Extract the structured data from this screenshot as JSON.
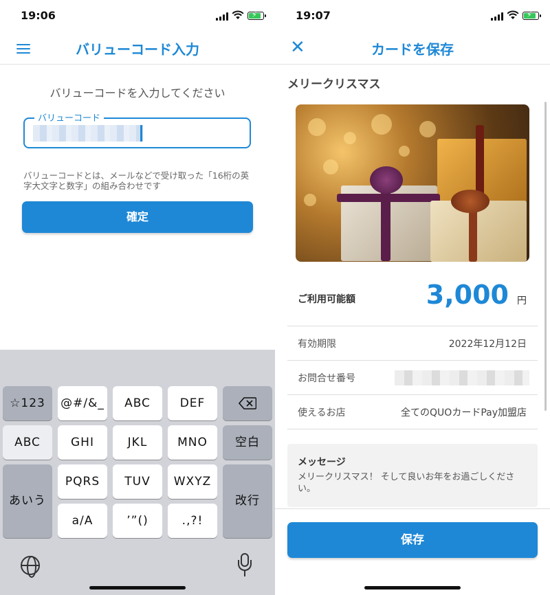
{
  "left": {
    "status_time": "19:06",
    "header_title": "バリューコード入力",
    "prompt": "バリューコードを入力してください",
    "field_label": "バリューコード",
    "help_text": "バリューコードとは、メールなどで受け取った「16桁の英字大文字と数字」の組み合わせです",
    "confirm_label": "確定",
    "keyboard": {
      "keys": [
        "☆123",
        "@#/&_",
        "ABC",
        "DEF",
        "ABC",
        "GHI",
        "JKL",
        "MNO",
        "空白",
        "あいう",
        "PQRS",
        "TUV",
        "WXYZ",
        "改行",
        "a/A",
        "’”()",
        ".,?!"
      ],
      "backspace_icon": "backspace-icon",
      "globe_icon": "globe-icon",
      "mic_icon": "microphone-icon"
    }
  },
  "right": {
    "status_time": "19:07",
    "header_title": "カードを保存",
    "card_name": "メリークリスマス",
    "amount_label": "ご利用可能額",
    "amount_value": "3,000",
    "amount_unit": "円",
    "rows": [
      {
        "key": "有効期限",
        "value": "2022年12月12日"
      },
      {
        "key": "お問合せ番号",
        "value": ""
      },
      {
        "key": "使えるお店",
        "value": "全てのQUOカードPay加盟店"
      }
    ],
    "message_title": "メッセージ",
    "message_text": "メリークリスマス！ そして良いお年をお過ごしください。",
    "save_label": "保存"
  },
  "colors": {
    "accent": "#1e88d6",
    "battery": "#35c759",
    "keyboard_bg": "#d1d3d9"
  }
}
